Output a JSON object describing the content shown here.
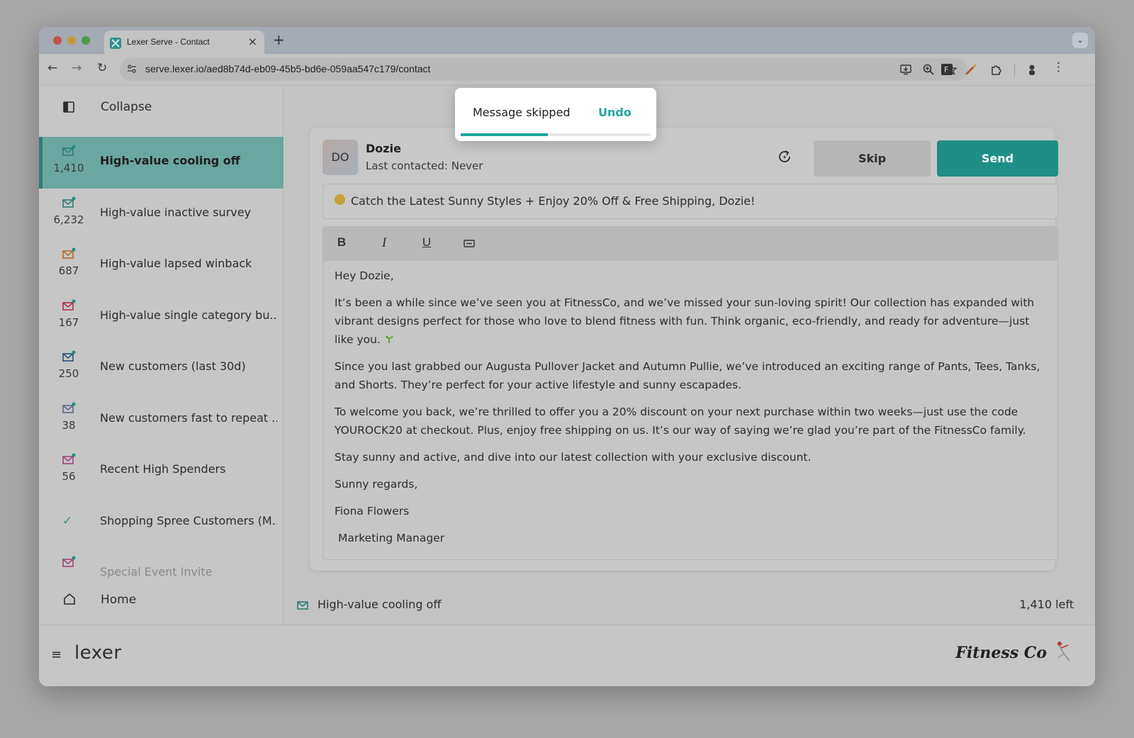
{
  "browser": {
    "tab_title": "Lexer Serve - Contact",
    "url": "serve.lexer.io/aed8b74d-eb09-45b5-bd6e-059aa547c179/contact",
    "new_tab_symbol": "+",
    "close_symbol": "×"
  },
  "sidebar": {
    "collapse_label": "Collapse",
    "items": [
      {
        "label": "High-value cooling off",
        "count": "1,410",
        "icon_color": "#2f7c76",
        "active": true
      },
      {
        "label": "High-value inactive survey",
        "count": "6,232",
        "icon_color": "#2f7c76"
      },
      {
        "label": "High-value lapsed winback",
        "count": "687",
        "icon_color": "#b06a2b"
      },
      {
        "label": "High-value single category bu...",
        "count": "167",
        "icon_color": "#b0304a"
      },
      {
        "label": "New customers (last 30d)",
        "count": "250",
        "icon_color": "#2c4f7a"
      },
      {
        "label": "New customers fast to repeat ...",
        "count": "38",
        "icon_color": "#5a6a8a"
      },
      {
        "label": "Recent High Spenders",
        "count": "56",
        "icon_color": "#a0447a"
      },
      {
        "label": "Shopping Spree Customers (M...",
        "count": "",
        "icon": "check-icon"
      },
      {
        "label": "Special Event Invite",
        "count": "",
        "icon_color": "#a0447a",
        "dim": true
      }
    ],
    "home_label": "Home"
  },
  "contact": {
    "initials": "DO",
    "name": "Dozie",
    "last_contacted": "Last contacted: Never"
  },
  "actions": {
    "skip_label": "Skip",
    "send_label": "Send",
    "accent_color": "#1f8f86"
  },
  "email": {
    "subject": "Catch the Latest Sunny Styles + Enjoy 20% Off & Free Shipping, Dozie!",
    "greeting": "Hey Dozie,",
    "paragraph_1": "It’s been a while since we’ve seen you at FitnessCo, and we’ve missed your sun-loving spirit! Our collection has expanded with vibrant designs perfect for those who love to blend fitness with fun. Think organic, eco-friendly, and ready for adventure—just like you.",
    "paragraph_2": "Since you last grabbed our Augusta Pullover Jacket and Autumn Pullie, we’ve introduced an exciting range of Pants, Tees, Tanks, and Shorts. They’re perfect for your active lifestyle and sunny escapades.",
    "paragraph_3": "To welcome you back, we’re thrilled to offer you a 20% discount on your next purchase within two weeks—just use the code YOUROCK20 at checkout. Plus, enjoy free shipping on us. It’s our way of saying we’re glad you’re part of the FitnessCo family.",
    "paragraph_4": "Stay sunny and active, and dive into our latest collection with your exclusive discount.",
    "signoff": "Sunny regards,",
    "sender_name": "Fiona Flowers",
    "sender_title": "Marketing Manager"
  },
  "footer": {
    "segment_name": "High-value cooling off",
    "remaining": "1,410 left"
  },
  "bottombar": {
    "app_logo": "lexer",
    "brand_logo": "Fitness Co"
  },
  "toast": {
    "message": "Message skipped",
    "undo_label": "Undo",
    "progress": 0.46,
    "accent_color": "#1fa79d"
  }
}
